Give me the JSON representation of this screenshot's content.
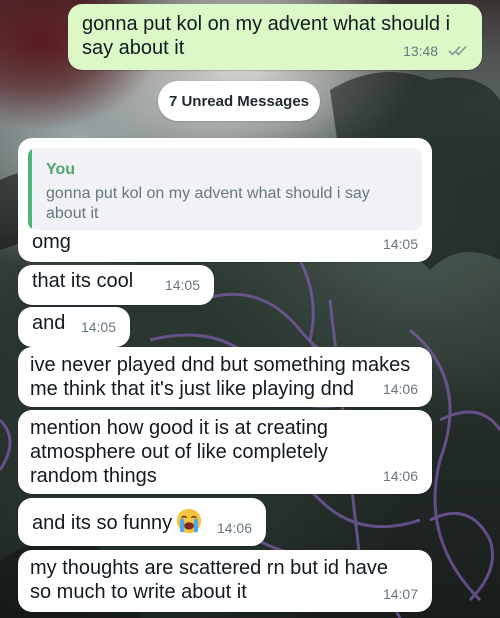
{
  "unread_banner": "7 Unread Messages",
  "outgoing": {
    "text": "gonna put kol on my advent what should i say about it",
    "time": "13:48"
  },
  "reply": {
    "quote_author": "You",
    "quote_text": "gonna put kol on my advent what should i say about it",
    "text": "omg",
    "time": "14:05"
  },
  "messages": [
    {
      "text": "that its cool",
      "time": "14:05"
    },
    {
      "text": "and",
      "time": "14:05"
    },
    {
      "text": "ive never played dnd but something makes me think that it's just like playing dnd",
      "time": "14:06"
    },
    {
      "text": "mention how good it is at creating atmosphere out of like completely random things",
      "time": "14:06"
    },
    {
      "text": "and its so funny",
      "emoji": "loudly-crying-face",
      "time": "14:06"
    },
    {
      "text": "my thoughts are scattered rn but id have so much to write about it",
      "time": "14:07"
    }
  ],
  "colors": {
    "incoming_bubble": "#ffffff",
    "outgoing_bubble": "#dcf8c6",
    "quote_accent": "#4fb476",
    "timestamp": "#667781",
    "read_ticks": "#8696a0"
  }
}
